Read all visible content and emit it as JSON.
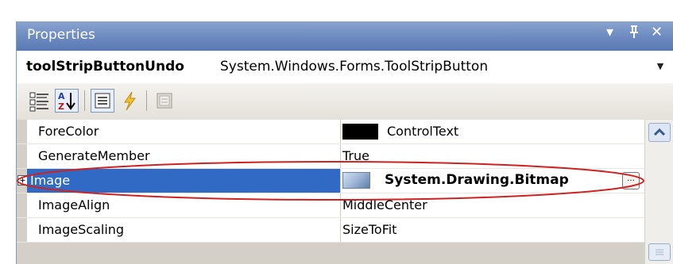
{
  "window": {
    "title": "Properties",
    "buttons": {
      "dropdown": "▾",
      "pin": "ᵖ",
      "close": "✕"
    }
  },
  "object_selector": {
    "name": "toolStripButtonUndo",
    "type": "System.Windows.Forms.ToolStripButton",
    "arrow": "▼"
  },
  "toolbar": {
    "buttons": [
      {
        "icon": "categorized-icon",
        "active": false
      },
      {
        "icon": "alphabetical-sort-icon",
        "active": true
      },
      {
        "icon": "properties-page-icon",
        "active": true
      },
      {
        "icon": "events-lightning-icon",
        "active": false
      },
      {
        "icon": "property-pages-icon",
        "active": false
      }
    ]
  },
  "grid": {
    "rows": [
      {
        "name": "ForeColor",
        "value": "ControlText",
        "swatch_color": "#000000"
      },
      {
        "name": "GenerateMember",
        "value": "True"
      },
      {
        "name": "Image",
        "value": "System.Drawing.Bitmap",
        "selected": true,
        "expandable": true,
        "expander": "+",
        "ellipsis": "..."
      },
      {
        "name": "ImageAlign",
        "value": "MiddleCenter"
      },
      {
        "name": "ImageScaling",
        "value": "SizeToFit"
      }
    ]
  },
  "colors": {
    "title_bar": "#6c8ac0",
    "selection": "#316ac5",
    "annotation_ellipse": "#cc2222"
  }
}
